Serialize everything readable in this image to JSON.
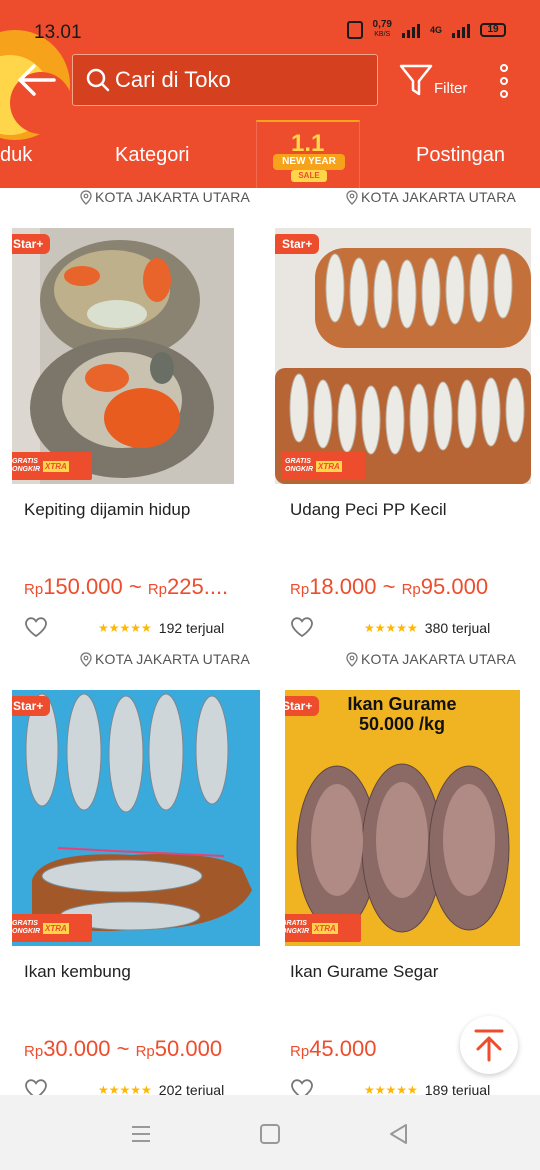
{
  "status_bar": {
    "time": "13.01",
    "speed_value": "0,79",
    "speed_unit": "KB/S",
    "network": "4G",
    "battery": "19"
  },
  "header": {
    "search_placeholder": "Cari di Toko",
    "filter_label": "Filter"
  },
  "tabs": {
    "produk": "duk",
    "kategori": "Kategori",
    "new_year_number": "1.1",
    "new_year_label": "NEW YEAR",
    "new_year_sale": "SALE",
    "postingan": "Postingan"
  },
  "badges": {
    "star": "Star+",
    "gratis_line1": "GRATIS",
    "gratis_line2": "ONGKIR",
    "xtra": "XTRA"
  },
  "products": [
    {
      "location": "KOTA JAKARTA UTARA",
      "name": "Kepiting dijamin hidup",
      "price_min": "150.000",
      "price_max": "225....",
      "sold": "192 terjual"
    },
    {
      "location": "KOTA JAKARTA UTARA",
      "name": "Udang Peci PP Kecil",
      "price_min": "18.000",
      "price_max": "95.000",
      "sold": "380 terjual"
    },
    {
      "location": "KOTA JAKARTA UTARA",
      "name": "Ikan kembung",
      "price_min": "30.000",
      "price_max": "50.000",
      "sold": "202 terjual"
    },
    {
      "location": "KOTA JAKARTA UTARA",
      "name": "Ikan Gurame Segar",
      "price_min": "45.000",
      "sold": "189 terjual",
      "image_caption_line1": "Ikan Gurame",
      "image_caption_line2": "50.000 /kg"
    }
  ],
  "currency": "Rp",
  "price_separator": "~",
  "colors": {
    "brand": "#ee4d2d",
    "star": "#ffb700",
    "accent_yellow": "#ffd54a"
  },
  "icons": [
    "back-arrow-icon",
    "search-icon",
    "filter-icon",
    "more-vertical-icon",
    "location-pin-icon",
    "heart-icon",
    "star-icon",
    "back-to-top-icon",
    "menu-nav-icon",
    "home-nav-icon",
    "back-nav-icon"
  ]
}
